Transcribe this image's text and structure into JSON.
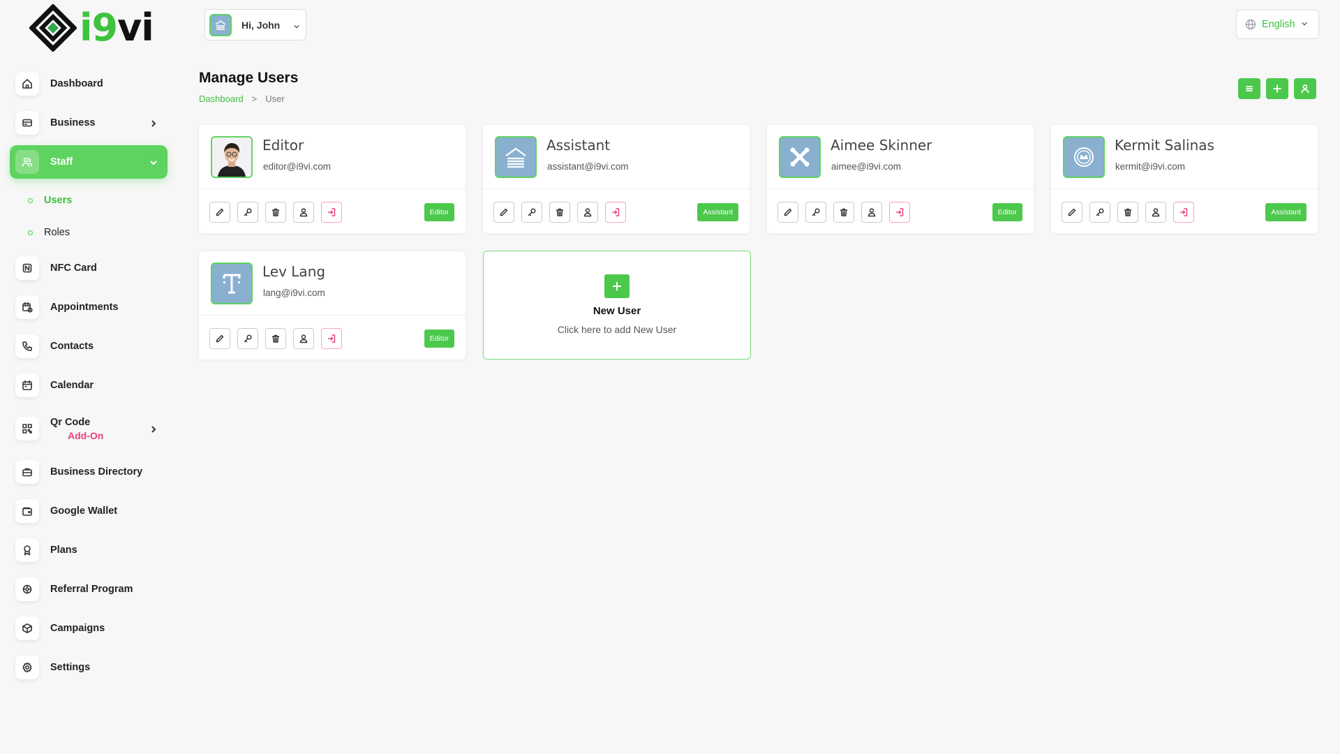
{
  "brand": {
    "logo_text_green": "i9",
    "logo_text_dark": "vi"
  },
  "header": {
    "greeting": "Hi, John",
    "language": "English"
  },
  "sidebar": {
    "items": [
      {
        "label": "Dashboard",
        "icon": "home-icon"
      },
      {
        "label": "Business",
        "icon": "card-icon"
      },
      {
        "label": "Staff",
        "icon": "users-icon"
      },
      {
        "label": "NFC Card",
        "icon": "nfc-icon"
      },
      {
        "label": "Appointments",
        "icon": "calendar-clock-icon"
      },
      {
        "label": "Contacts",
        "icon": "phone-icon"
      },
      {
        "label": "Calendar",
        "icon": "calendar-icon"
      },
      {
        "label": "Qr Code",
        "icon": "qr-icon",
        "badge": "Add-On"
      },
      {
        "label": "Business Directory",
        "icon": "briefcase-icon"
      },
      {
        "label": "Google Wallet",
        "icon": "wallet-icon"
      },
      {
        "label": "Plans",
        "icon": "award-icon"
      },
      {
        "label": "Referral Program",
        "icon": "gear-badge-icon"
      },
      {
        "label": "Campaigns",
        "icon": "box-icon"
      },
      {
        "label": "Settings",
        "icon": "settings-icon"
      }
    ],
    "staff_sub": [
      {
        "label": "Users"
      },
      {
        "label": "Roles"
      }
    ]
  },
  "page": {
    "title": "Manage Users",
    "breadcrumb": {
      "home": "Dashboard",
      "separator": ">",
      "current": "User"
    }
  },
  "users": [
    {
      "name": "Editor",
      "email": "editor@i9vi.com",
      "role": "Editor"
    },
    {
      "name": "Assistant",
      "email": "assistant@i9vi.com",
      "role": "Assistant"
    },
    {
      "name": "Aimee Skinner",
      "email": "aimee@i9vi.com",
      "role": "Editor"
    },
    {
      "name": "Kermit Salinas",
      "email": "kermit@i9vi.com",
      "role": "Assistant"
    },
    {
      "name": "Lev Lang",
      "email": "lang@i9vi.com",
      "role": "Editor"
    }
  ],
  "new_user": {
    "title": "New User",
    "subtitle": "Click here to add New User"
  },
  "colors": {
    "accent": "#4cc94c",
    "pink": "#ec407a",
    "avatar_bg": "#8ab0d0"
  }
}
